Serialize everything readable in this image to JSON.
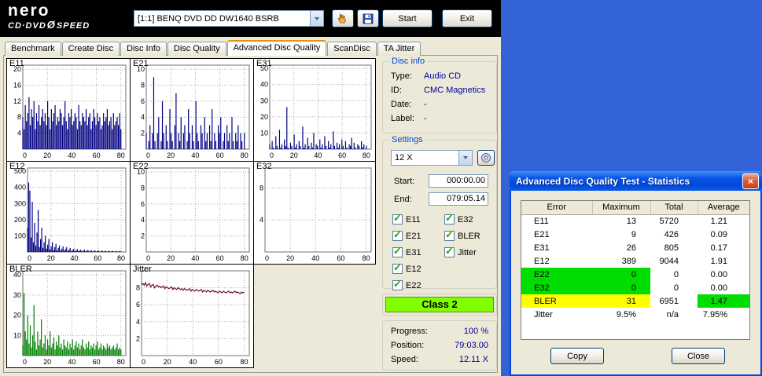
{
  "app": {
    "logo": {
      "brand": "nero",
      "product": "CD·DVD",
      "glyph": "Ø",
      "speed": "SPEED"
    },
    "toolbar": {
      "drive_value": "[1:1]   BENQ DVD DD DW1640 BSRB",
      "start_label": "Start",
      "exit_label": "Exit"
    },
    "tabs": [
      {
        "label": "Benchmark",
        "active": false
      },
      {
        "label": "Create Disc",
        "active": false
      },
      {
        "label": "Disc Info",
        "active": false
      },
      {
        "label": "Disc Quality",
        "active": false
      },
      {
        "label": "Advanced Disc Quality",
        "active": true
      },
      {
        "label": "ScanDisc",
        "active": false
      },
      {
        "label": "TA Jitter",
        "active": false
      }
    ]
  },
  "disc_info": {
    "title": "Disc info",
    "rows": [
      {
        "label": "Type:",
        "value": "Audio CD"
      },
      {
        "label": "ID:",
        "value": "CMC Magnetics"
      },
      {
        "label": "Date:",
        "value": "-"
      },
      {
        "label": "Label:",
        "value": "-"
      }
    ]
  },
  "settings": {
    "title": "Settings",
    "speed_value": "12 X",
    "start_label": "Start:",
    "start_value": "000:00.00",
    "end_label": "End:",
    "end_value": "079:05.14",
    "checkboxes_left": [
      {
        "label": "E11",
        "checked": true
      },
      {
        "label": "E21",
        "checked": true
      },
      {
        "label": "E31",
        "checked": true
      },
      {
        "label": "E12",
        "checked": true
      },
      {
        "label": "E22",
        "checked": true
      }
    ],
    "checkboxes_right": [
      {
        "label": "E32",
        "checked": true
      },
      {
        "label": "BLER",
        "checked": true
      },
      {
        "label": "Jitter",
        "checked": true
      }
    ]
  },
  "classification": {
    "label": "Class 2",
    "color": "#80ff00"
  },
  "progress": {
    "rows": [
      {
        "label": "Progress:",
        "value": "100 %"
      },
      {
        "label": "Position:",
        "value": "79:03.00"
      },
      {
        "label": "Speed:",
        "value": "12.11 X"
      }
    ]
  },
  "stats_window": {
    "title": "Advanced Disc Quality Test - Statistics",
    "headers": [
      "Error",
      "Maximum",
      "Total",
      "Average"
    ],
    "highlight_colors": {
      "green": "#00dd00",
      "yellow": "#ffff00"
    },
    "rows": [
      {
        "error": "E11",
        "maximum": "13",
        "total": "5720",
        "average": "1.21",
        "hl": {}
      },
      {
        "error": "E21",
        "maximum": "9",
        "total": "426",
        "average": "0.09",
        "hl": {}
      },
      {
        "error": "E31",
        "maximum": "26",
        "total": "805",
        "average": "0.17",
        "hl": {}
      },
      {
        "error": "E12",
        "maximum": "389",
        "total": "9044",
        "average": "1.91",
        "hl": {}
      },
      {
        "error": "E22",
        "maximum": "0",
        "total": "0",
        "average": "0.00",
        "hl": {
          "error": "green",
          "maximum": "green"
        }
      },
      {
        "error": "E32",
        "maximum": "0",
        "total": "0",
        "average": "0.00",
        "hl": {
          "error": "green",
          "maximum": "green"
        }
      },
      {
        "error": "BLER",
        "maximum": "31",
        "total": "6951",
        "average": "1.47",
        "hl": {
          "error": "yellow",
          "maximum": "yellow",
          "average": "green"
        }
      },
      {
        "error": "Jitter",
        "maximum": "9.5%",
        "total": "n/a",
        "average": "7.95%",
        "hl": {}
      }
    ],
    "copy_label": "Copy",
    "close_label": "Close"
  },
  "chart_data": [
    {
      "type": "bar",
      "title": "E11",
      "color": "#000080",
      "ylim": [
        0,
        21
      ],
      "yticks": [
        4,
        8,
        12,
        16,
        20
      ],
      "xlim": [
        0,
        84
      ],
      "xticks": [
        0,
        20,
        40,
        60,
        80
      ],
      "values": [
        8,
        5,
        11,
        7,
        9,
        13,
        6,
        10,
        8,
        12,
        5,
        9,
        7,
        11,
        6,
        8,
        10,
        7,
        9,
        6,
        12,
        8,
        5,
        10,
        7,
        9,
        11,
        6,
        8,
        7,
        10,
        9,
        6,
        8,
        12,
        7,
        5,
        9,
        8,
        10,
        6,
        7,
        9,
        8,
        5,
        11,
        7,
        6,
        9,
        8,
        7,
        10,
        6,
        8,
        9,
        5,
        7,
        10,
        8,
        6,
        9,
        7,
        8,
        5,
        6,
        9,
        7,
        8,
        10,
        6,
        7,
        8,
        5,
        9,
        6,
        7,
        8,
        6,
        9,
        5
      ]
    },
    {
      "type": "bar",
      "title": "E21",
      "color": "#000080",
      "ylim": [
        0,
        10.5
      ],
      "yticks": [
        2,
        4,
        6,
        8,
        10
      ],
      "xlim": [
        0,
        84
      ],
      "xticks": [
        0,
        20,
        40,
        60,
        80
      ],
      "values": [
        2,
        0,
        1,
        3,
        0,
        2,
        9,
        1,
        0,
        2,
        4,
        0,
        1,
        6,
        2,
        0,
        3,
        1,
        0,
        5,
        2,
        1,
        0,
        3,
        7,
        0,
        2,
        1,
        4,
        0,
        2,
        3,
        0,
        1,
        5,
        2,
        0,
        3,
        1,
        0,
        6,
        2,
        1,
        0,
        3,
        2,
        0,
        4,
        1,
        2,
        0,
        3,
        1,
        5,
        0,
        2,
        1,
        0,
        3,
        2,
        4,
        0,
        1,
        2,
        0,
        3,
        1,
        2,
        0,
        4,
        1,
        0,
        2,
        1,
        3,
        0,
        2,
        1,
        0,
        2
      ]
    },
    {
      "type": "bar",
      "title": "E31",
      "color": "#000080",
      "ylim": [
        0,
        52
      ],
      "yticks": [
        10,
        20,
        30,
        40,
        50
      ],
      "xlim": [
        0,
        84
      ],
      "xticks": [
        0,
        20,
        40,
        60,
        80
      ],
      "values": [
        3,
        0,
        5,
        1,
        0,
        8,
        2,
        0,
        12,
        1,
        3,
        0,
        6,
        2,
        26,
        1,
        0,
        4,
        2,
        0,
        9,
        1,
        3,
        0,
        5,
        2,
        0,
        14,
        1,
        3,
        0,
        7,
        2,
        0,
        4,
        1,
        10,
        0,
        3,
        2,
        0,
        6,
        1,
        3,
        0,
        8,
        2,
        0,
        5,
        1,
        3,
        0,
        11,
        2,
        0,
        4,
        1,
        3,
        0,
        6,
        2,
        0,
        5,
        1,
        0,
        3,
        2,
        7,
        0,
        4,
        1,
        0,
        3,
        2,
        0,
        5,
        1,
        3,
        0,
        2
      ]
    },
    {
      "type": "bar",
      "title": "E12",
      "color": "#000080",
      "ylim": [
        0,
        520
      ],
      "yticks": [
        100,
        200,
        300,
        400,
        500
      ],
      "xlim": [
        0,
        84
      ],
      "xticks": [
        0,
        20,
        40,
        60,
        80
      ],
      "values": [
        150,
        430,
        380,
        90,
        310,
        60,
        180,
        40,
        120,
        260,
        30,
        80,
        150,
        25,
        60,
        100,
        20,
        45,
        80,
        15,
        35,
        60,
        12,
        30,
        50,
        10,
        25,
        40,
        8,
        20,
        35,
        8,
        18,
        30,
        6,
        15,
        25,
        6,
        12,
        20,
        5,
        10,
        18,
        5,
        10,
        15,
        4,
        8,
        14,
        4,
        8,
        12,
        4,
        7,
        10,
        3,
        7,
        10,
        3,
        6,
        9,
        3,
        6,
        8,
        3,
        5,
        8,
        2,
        5,
        7,
        2,
        5,
        7,
        2,
        4,
        6,
        2,
        4,
        6,
        3
      ]
    },
    {
      "type": "bar",
      "title": "E22",
      "color": "#000080",
      "ylim": [
        0,
        10.5
      ],
      "yticks": [
        2,
        4,
        6,
        8,
        10
      ],
      "xlim": [
        0,
        84
      ],
      "xticks": [
        0,
        20,
        40,
        60,
        80
      ],
      "values": []
    },
    {
      "type": "bar",
      "title": "E32",
      "color": "#000080",
      "ylim": [
        0,
        10.5
      ],
      "yticks": [
        4,
        8
      ],
      "xlim": [
        0,
        84
      ],
      "xticks": [
        0,
        20,
        40,
        60,
        80
      ],
      "values": []
    },
    {
      "type": "bar",
      "title": "BLER",
      "color": "#008000",
      "ylim": [
        0,
        42
      ],
      "yticks": [
        10,
        20,
        30,
        40
      ],
      "xlim": [
        0,
        84
      ],
      "xticks": [
        0,
        20,
        40,
        60,
        80
      ],
      "values": [
        5,
        31,
        12,
        8,
        20,
        6,
        15,
        4,
        10,
        25,
        7,
        3,
        12,
        5,
        8,
        18,
        4,
        6,
        10,
        3,
        8,
        5,
        12,
        4,
        6,
        9,
        3,
        7,
        5,
        10,
        4,
        6,
        3,
        8,
        5,
        4,
        7,
        3,
        6,
        4,
        8,
        3,
        5,
        7,
        4,
        6,
        3,
        5,
        8,
        4,
        3,
        6,
        4,
        7,
        3,
        5,
        4,
        6,
        3,
        5,
        7,
        3,
        4,
        6,
        3,
        5,
        4,
        3,
        6,
        4,
        5,
        3,
        4,
        5,
        3,
        4,
        6,
        3,
        4,
        3
      ]
    },
    {
      "type": "line",
      "title": "Jitter",
      "color": "#6e0f33",
      "ylim": [
        0,
        10
      ],
      "yticks": [
        2,
        4,
        6,
        8
      ],
      "xlim": [
        0,
        84
      ],
      "xticks": [
        0,
        20,
        40,
        60,
        80
      ],
      "values": [
        8.4,
        8.5,
        8.3,
        8.6,
        8.2,
        8.4,
        8.5,
        8.1,
        8.3,
        8.4,
        8.0,
        8.2,
        8.3,
        8.1,
        8.2,
        8.0,
        8.1,
        8.2,
        7.9,
        8.1,
        8.0,
        7.9,
        8.0,
        8.1,
        7.8,
        8.0,
        7.9,
        7.8,
        8.0,
        7.9,
        7.8,
        7.9,
        7.7,
        7.9,
        7.8,
        7.7,
        7.8,
        7.9,
        7.6,
        7.8,
        7.7,
        7.6,
        7.8,
        7.7,
        7.6,
        7.7,
        7.8,
        7.5,
        7.7,
        7.6,
        7.5,
        7.7,
        7.6,
        7.5,
        7.6,
        7.7,
        7.5,
        7.6,
        7.5,
        7.4,
        7.6,
        7.5,
        7.4,
        7.6,
        7.5,
        7.4,
        7.5,
        7.6,
        7.4,
        7.5,
        7.4,
        7.5,
        7.6,
        7.4,
        7.5,
        7.4,
        7.3,
        7.5,
        7.4,
        7.5
      ]
    }
  ]
}
